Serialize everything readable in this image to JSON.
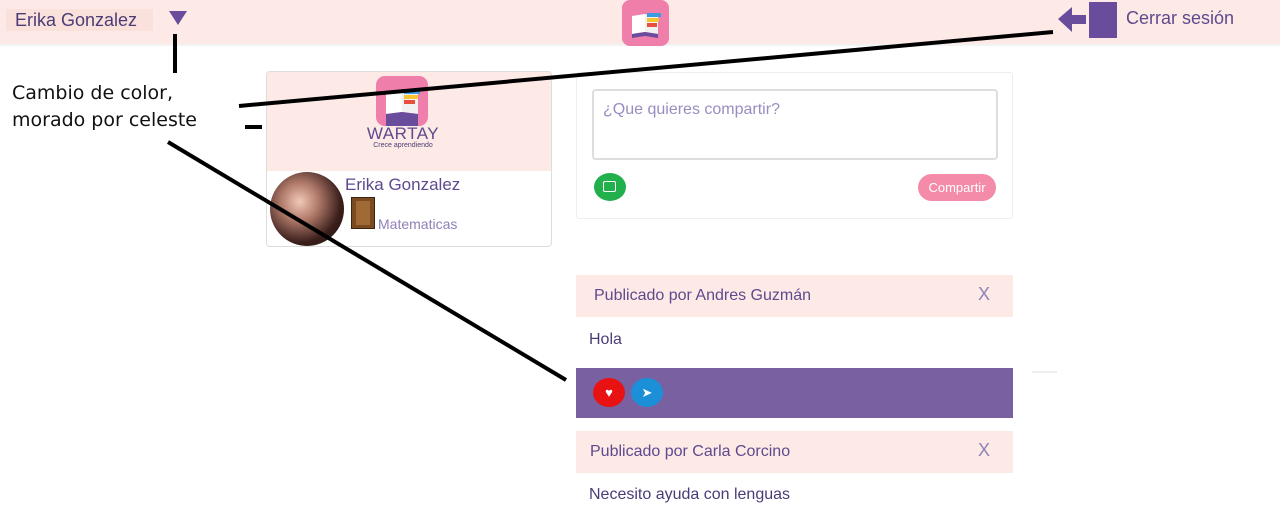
{
  "header": {
    "user_name": "Erika Gonzalez",
    "logout_label": "Cerrar sesión",
    "icons": {
      "dropdown": "triangle-down-icon",
      "logo": "wartay-book-logo",
      "logout": "arrow-left-door-icon"
    }
  },
  "profile": {
    "brand_name": "WARTAY",
    "brand_tagline": "Crece aprendiendo",
    "name": "Erika Gonzalez",
    "subject": "Matematicas"
  },
  "composer": {
    "placeholder": "¿Que quieres compartir?",
    "share_label": "Compartir"
  },
  "posts": [
    {
      "author": "Publicado por Andres Guzmán",
      "close": "X",
      "body": "Hola"
    },
    {
      "author": "Publicado por Carla Corcino",
      "close": "X",
      "body": "Necesito ayuda con lenguas"
    }
  ],
  "annotation": {
    "line1": "Cambio de color,",
    "line2": "morado por celeste"
  },
  "colors": {
    "header_bg": "#fde9e5",
    "accent_purple": "#7960a0",
    "share_pink": "#f48ba8",
    "like_red": "#e81212",
    "send_blue": "#1b8fd8",
    "image_green": "#22b04d"
  }
}
